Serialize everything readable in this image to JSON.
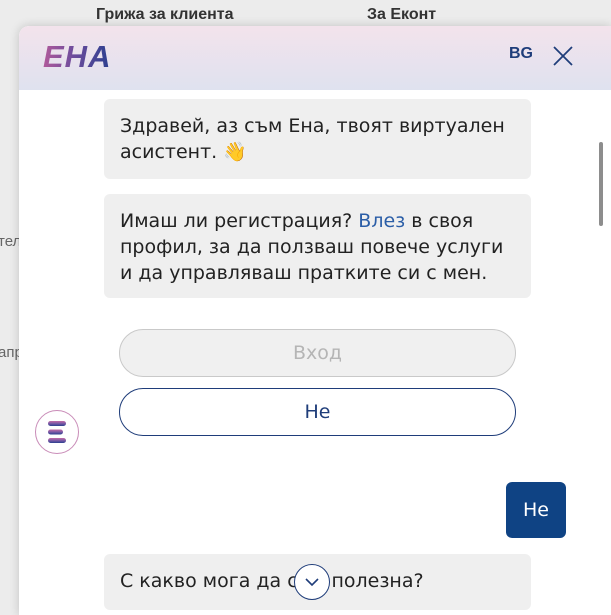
{
  "background_page": {
    "nav": [
      "Грижа за клиента",
      "За Еконт"
    ],
    "side_fragments": [
      "тел",
      "апр"
    ]
  },
  "chat": {
    "brand": "ЕНА",
    "language": "BG",
    "messages": {
      "greeting": "Здравей, аз съм Ена, твоят виртуален асистент. 👋",
      "registration_before": "Имаш ли регистрация? ",
      "registration_link": "Влез",
      "registration_after": " в своя профил, за да ползваш повече услуги и да управляваш пратките си с мен.",
      "user_reply": "Не",
      "followup": "С какво мога да съм полезна?"
    },
    "options": {
      "login": "Вход",
      "no": "Не"
    }
  },
  "colors": {
    "accent": "#1f3d7a",
    "user_bubble": "#0f4384",
    "bubble_bg": "#efefef",
    "link": "#2b5ea7"
  },
  "icons": {
    "close": "close-icon",
    "scroll_down": "chevron-down-icon",
    "avatar": "ena-avatar-icon"
  }
}
